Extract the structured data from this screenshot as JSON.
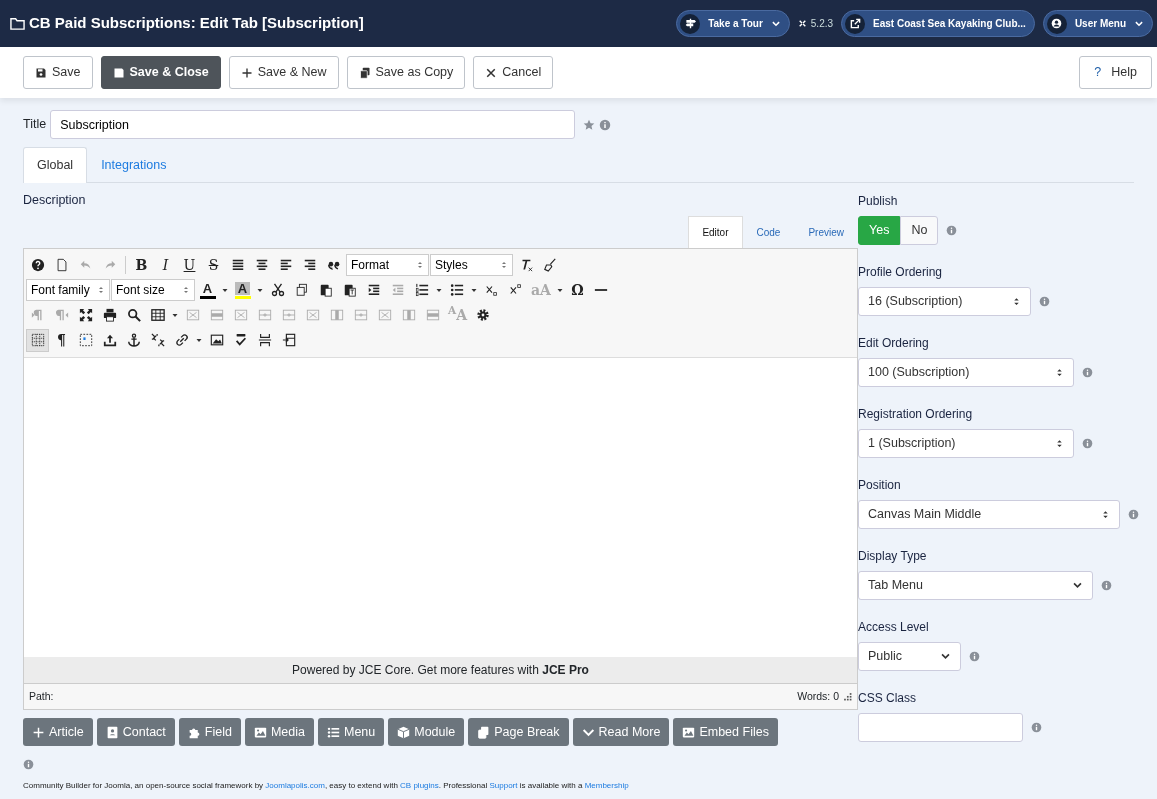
{
  "header": {
    "title": "CB Paid Subscriptions: Edit Tab [Subscription]",
    "tour": "Take a Tour",
    "version": "5.2.3",
    "site": "East Coast Sea Kayaking Club...",
    "user": "User Menu"
  },
  "toolbar": [
    {
      "label": "Save",
      "kind": "default"
    },
    {
      "label": "Save & Close",
      "kind": "primary"
    },
    {
      "label": "Save & New",
      "kind": "default"
    },
    {
      "label": "Save as Copy",
      "kind": "default"
    },
    {
      "label": "Cancel",
      "kind": "default"
    }
  ],
  "help": {
    "icon": "?",
    "label": "Help"
  },
  "title_field": {
    "label": "Title",
    "value": "Subscription"
  },
  "tabs": [
    {
      "label": "Global",
      "selected": true
    },
    {
      "label": "Integrations",
      "selected": false
    }
  ],
  "description_label": "Description",
  "editor_tabs": [
    {
      "label": "Editor",
      "selected": true
    },
    {
      "label": "Code",
      "selected": false
    },
    {
      "label": "Preview",
      "selected": false
    }
  ],
  "editor_toolbar": [
    [
      {
        "kind": "icon",
        "disabled": false
      },
      {
        "kind": "icon",
        "disabled": false
      },
      {
        "kind": "icon",
        "disabled": true
      },
      {
        "kind": "icon",
        "disabled": true
      },
      {
        "kind": "sep"
      },
      {
        "kind": "bold",
        "text": "B",
        "disabled": false
      },
      {
        "kind": "italic",
        "text": "I",
        "disabled": false
      },
      {
        "kind": "underline",
        "text": "U",
        "disabled": false
      },
      {
        "kind": "strike",
        "text": "S",
        "disabled": false
      },
      {
        "kind": "icon",
        "disabled": false
      },
      {
        "kind": "icon",
        "disabled": false
      },
      {
        "kind": "icon",
        "disabled": false
      },
      {
        "kind": "icon",
        "disabled": false
      },
      {
        "kind": "icon",
        "disabled": false
      },
      {
        "kind": "select",
        "text": "Format"
      },
      {
        "kind": "select",
        "text": "Styles"
      },
      {
        "kind": "icon",
        "disabled": false
      },
      {
        "kind": "icon",
        "disabled": false
      }
    ],
    [
      {
        "kind": "select",
        "text": "Font family"
      },
      {
        "kind": "select",
        "text": "Font size"
      },
      {
        "kind": "color",
        "text": "A",
        "color": "#000000"
      },
      {
        "kind": "caret"
      },
      {
        "kind": "color",
        "text": "A",
        "color": "#ffff00"
      },
      {
        "kind": "caret"
      },
      {
        "kind": "icon",
        "disabled": false
      },
      {
        "kind": "icon",
        "disabled": false
      },
      {
        "kind": "icon",
        "disabled": false
      },
      {
        "kind": "icon",
        "disabled": false
      },
      {
        "kind": "icon",
        "disabled": false
      },
      {
        "kind": "icon",
        "disabled": true
      },
      {
        "kind": "icon",
        "disabled": false
      },
      {
        "kind": "caret"
      },
      {
        "kind": "icon",
        "disabled": false
      },
      {
        "kind": "caret"
      },
      {
        "kind": "icon",
        "disabled": false
      },
      {
        "kind": "icon",
        "disabled": false
      },
      {
        "kind": "plain",
        "text": "aA",
        "disabled": true
      },
      {
        "kind": "caret"
      },
      {
        "kind": "plain",
        "text": "Ω",
        "disabled": false
      },
      {
        "kind": "icon",
        "disabled": false
      }
    ],
    [
      {
        "kind": "icon",
        "disabled": true
      },
      {
        "kind": "icon",
        "disabled": true
      },
      {
        "kind": "icon",
        "disabled": false
      },
      {
        "kind": "icon",
        "disabled": false
      },
      {
        "kind": "icon",
        "disabled": false
      },
      {
        "kind": "icon",
        "disabled": false
      },
      {
        "kind": "caret"
      },
      {
        "kind": "icon",
        "disabled": true
      },
      {
        "kind": "icon",
        "disabled": true
      },
      {
        "kind": "icon",
        "disabled": true
      },
      {
        "kind": "icon",
        "disabled": true
      },
      {
        "kind": "icon",
        "disabled": true
      },
      {
        "kind": "icon",
        "disabled": true
      },
      {
        "kind": "icon",
        "disabled": true
      },
      {
        "kind": "icon",
        "disabled": true
      },
      {
        "kind": "icon",
        "disabled": true
      },
      {
        "kind": "icon",
        "disabled": true
      },
      {
        "kind": "icon",
        "disabled": true
      },
      {
        "kind": "plain",
        "text": "$^{A}$A",
        "disabled": true
      },
      {
        "kind": "icon",
        "disabled": false
      }
    ],
    [
      {
        "kind": "icon",
        "disabled": false,
        "selected": true
      },
      {
        "kind": "plain",
        "text": "¶",
        "disabled": false
      },
      {
        "kind": "icon",
        "disabled": false
      },
      {
        "kind": "icon",
        "disabled": false
      },
      {
        "kind": "icon",
        "disabled": false
      },
      {
        "kind": "icon",
        "disabled": false
      },
      {
        "kind": "icon",
        "disabled": false
      },
      {
        "kind": "caret"
      },
      {
        "kind": "icon",
        "disabled": false
      },
      {
        "kind": "icon",
        "disabled": false
      },
      {
        "kind": "icon",
        "disabled": false
      },
      {
        "kind": "icon",
        "disabled": false
      }
    ]
  ],
  "editor_notice": "Powered by JCE Core. Get more features with **JCE Pro**",
  "path_label": "Path:",
  "word_count": "Words: 0",
  "insert_buttons": [
    "Article",
    "Contact",
    "Field",
    "Media",
    "Menu",
    "Module",
    "Page Break",
    "Read More",
    "Embed Files"
  ],
  "fields": [
    {
      "label": "Publish",
      "kind": "toggle",
      "options": [
        {
          "label": "Yes",
          "selected": true
        },
        {
          "label": "No",
          "selected": false
        }
      ]
    },
    {
      "label": "Profile Ordering",
      "kind": "ordering",
      "value": "16 (Subscription)"
    },
    {
      "label": "Edit Ordering",
      "kind": "ordering",
      "value": "100 (Subscription)"
    },
    {
      "label": "Registration Ordering",
      "kind": "ordering",
      "value": "1 (Subscription)"
    },
    {
      "label": "Position",
      "kind": "ordering",
      "value": "Canvas Main Middle"
    },
    {
      "label": "Display Type",
      "kind": "dropdown",
      "value": "Tab Menu"
    },
    {
      "label": "Access Level",
      "kind": "dropdown",
      "value": "Public"
    },
    {
      "label": "CSS Class",
      "kind": "text"
    }
  ],
  "footer": [
    {
      "text": "Community Builder for Joomla, an open-source social framework by ",
      "link": false
    },
    {
      "text": "Joomlapolis.com",
      "link": true
    },
    {
      "text": ", easy to extend with ",
      "link": false
    },
    {
      "text": "CB plugins",
      "link": true
    },
    {
      "text": ". Professional ",
      "link": false
    },
    {
      "text": "Support",
      "link": true
    },
    {
      "text": " is available with a ",
      "link": false
    },
    {
      "text": "Membership",
      "link": true
    }
  ]
}
